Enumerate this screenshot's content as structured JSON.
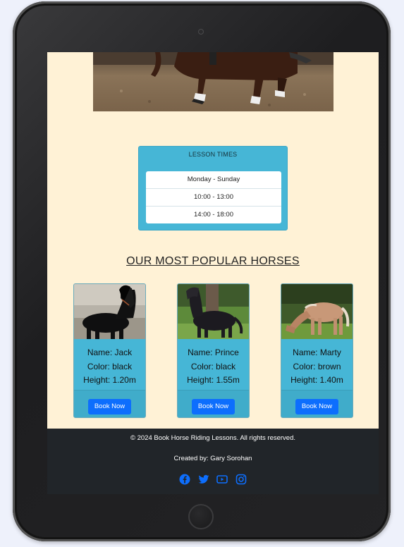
{
  "lesson_times": {
    "title": "LESSON TIMES",
    "rows": [
      "Monday - Sunday",
      "10:00 - 13:00",
      "14:00 - 18:00"
    ]
  },
  "popular": {
    "title": "OUR MOST POPULAR HORSES",
    "horses": [
      {
        "name": "Name: Jack",
        "color": "Color: black",
        "height": "Height: 1.20m",
        "button": "Book Now"
      },
      {
        "name": "Name: Prince",
        "color": "Color: black",
        "height": "Height: 1.55m",
        "button": "Book Now"
      },
      {
        "name": "Name: Marty",
        "color": "Color: brown",
        "height": "Height: 1.40m",
        "button": "Book Now"
      }
    ]
  },
  "footer": {
    "copyright": "© 2024 Book Horse Riding Lessons. All rights reserved.",
    "created_by": "Created by: Gary Sorohan",
    "social_icons": [
      "facebook-icon",
      "twitter-icon",
      "youtube-icon",
      "instagram-icon"
    ]
  },
  "colors": {
    "page_background": "#fff2d6",
    "card_accent": "#46b6d6",
    "button": "#0d6efd",
    "footer": "#212529",
    "social": "#0d6efd"
  }
}
